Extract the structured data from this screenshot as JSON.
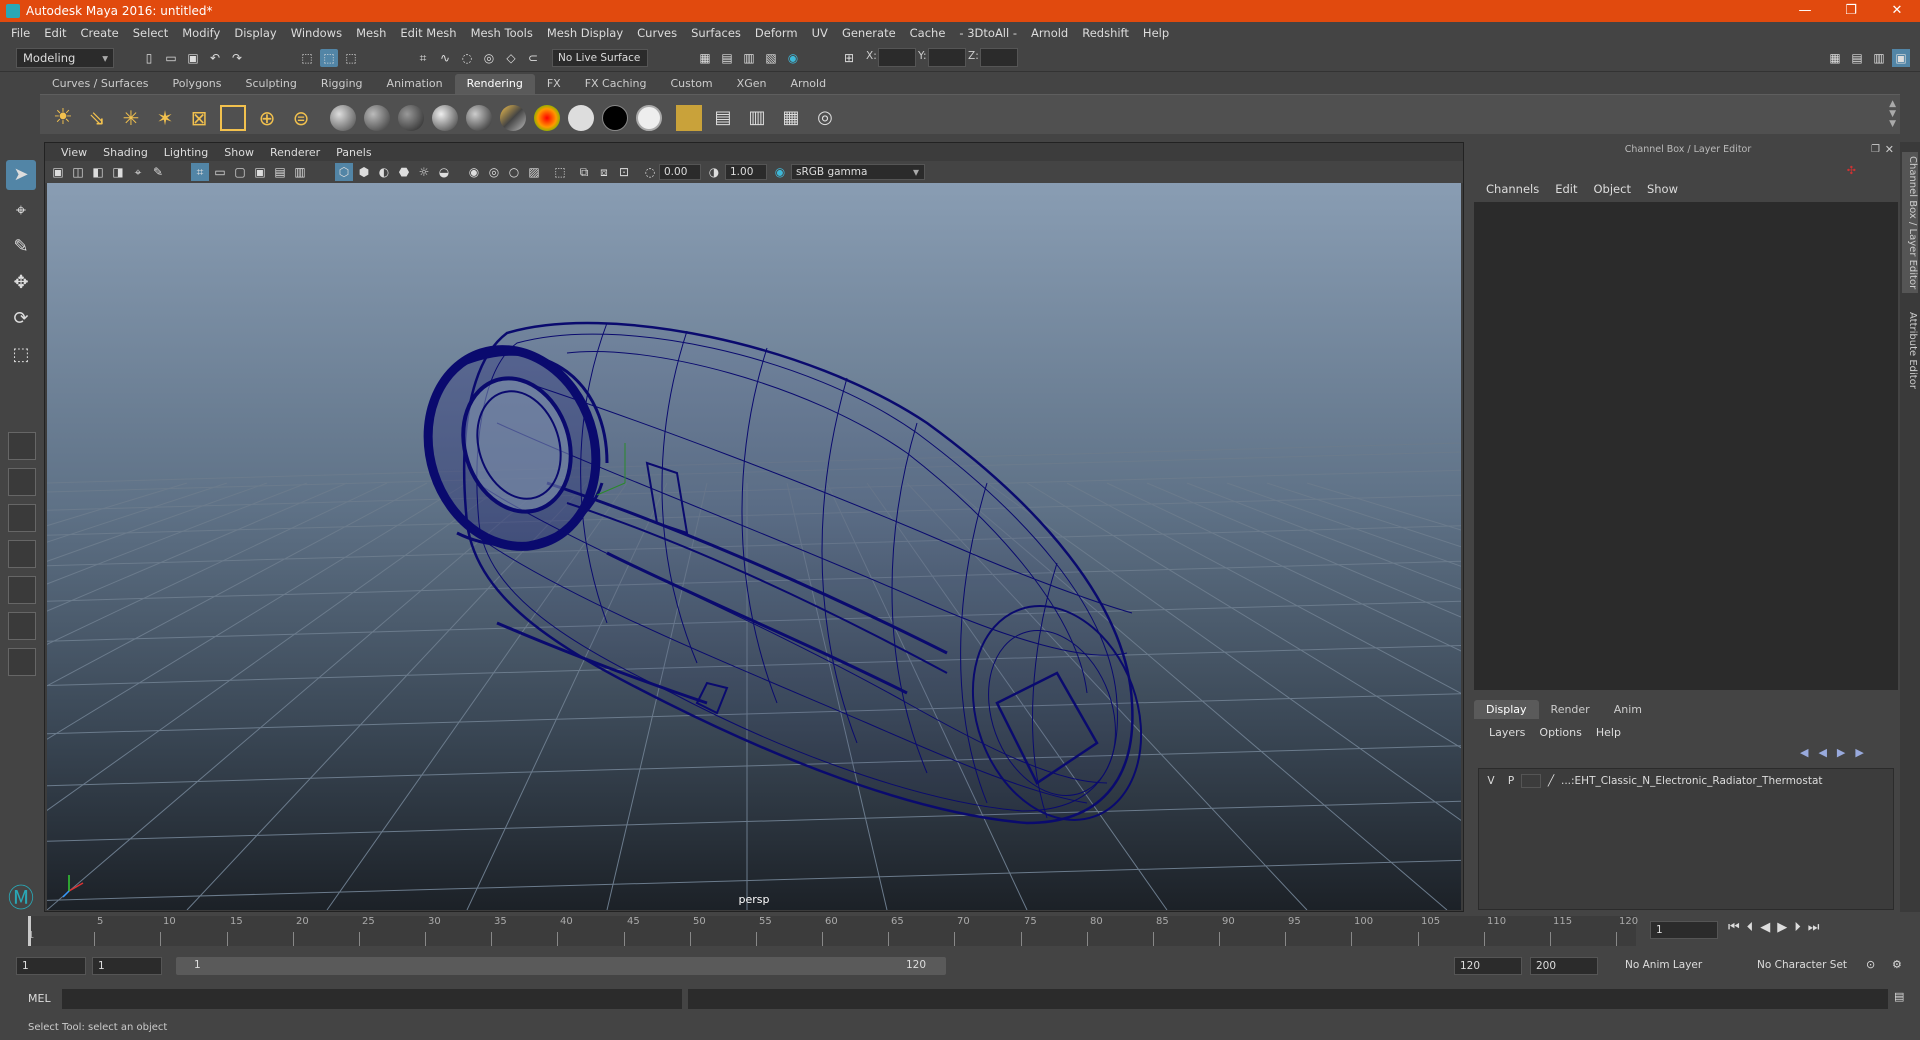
{
  "window": {
    "title": "Autodesk Maya 2016: untitled*",
    "buttons": [
      "—",
      "❐",
      "✕"
    ]
  },
  "menubar": [
    "File",
    "Edit",
    "Create",
    "Select",
    "Modify",
    "Display",
    "Windows",
    "Mesh",
    "Edit Mesh",
    "Mesh Tools",
    "Mesh Display",
    "Curves",
    "Surfaces",
    "Deform",
    "UV",
    "Generate",
    "Cache",
    "- 3DtoAll -",
    "Arnold",
    "Redshift",
    "Help"
  ],
  "statusline": {
    "mode": "Modeling",
    "live_surface": "No Live Surface",
    "x_label": "X:",
    "y_label": "Y:",
    "z_label": "Z:"
  },
  "shelf_tabs": [
    "Curves / Surfaces",
    "Polygons",
    "Sculpting",
    "Rigging",
    "Animation",
    "Rendering",
    "FX",
    "FX Caching",
    "Custom",
    "XGen",
    "Arnold"
  ],
  "shelf_active_tab": "Rendering",
  "viewport": {
    "menu": [
      "View",
      "Shading",
      "Lighting",
      "Show",
      "Renderer",
      "Panels"
    ],
    "exposure": "0.00",
    "gamma": "1.00",
    "color_space": "sRGB gamma",
    "camera_label": "persp"
  },
  "channel_box": {
    "header": "Channel Box / Layer Editor",
    "menu": [
      "Channels",
      "Edit",
      "Object",
      "Show"
    ]
  },
  "layer_editor": {
    "tabs": [
      "Display",
      "Render",
      "Anim"
    ],
    "active_tab": "Display",
    "menu": [
      "Layers",
      "Options",
      "Help"
    ],
    "layers": [
      {
        "v": "V",
        "p": "P",
        "name": "...:EHT_Classic_N_Electronic_Radiator_Thermostat"
      }
    ]
  },
  "side_tabs": [
    "Channel Box / Layer Editor",
    "Attribute Editor"
  ],
  "timeslider": {
    "ticks": [
      5,
      10,
      15,
      20,
      25,
      30,
      35,
      40,
      45,
      50,
      55,
      60,
      65,
      70,
      75,
      80,
      85,
      90,
      95,
      100,
      105,
      110,
      115,
      120
    ],
    "start_label": "1",
    "current_frame": "1"
  },
  "range": {
    "start": "1",
    "playback_start": "1",
    "slider_start": "1",
    "slider_end": "120",
    "playback_end": "120",
    "end": "200",
    "anim_layer": "No Anim Layer",
    "char_set": "No Character Set"
  },
  "cmdline": {
    "label": "MEL"
  },
  "helpline": "Select Tool: select an object",
  "colors": {
    "title_bar": "#e14a0e",
    "wireframe": "#0a0a6e",
    "active_tool": "#5285a6"
  }
}
